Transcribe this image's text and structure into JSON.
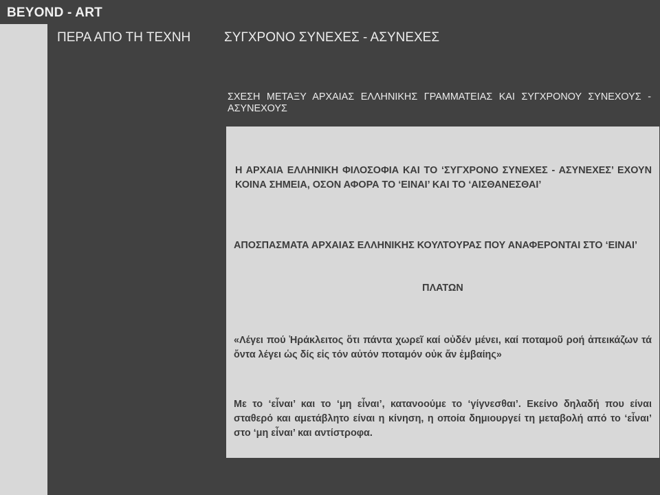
{
  "header": {
    "logo": "BEYOND - ART"
  },
  "nav": {
    "items": [
      {
        "label": "ΠΕΡΑ ΑΠΟ ΤΗ ΤΕΧΝΗ"
      },
      {
        "label": "ΣΥΓΧΡΟΝΟ ΣΥΝΕΧΕΣ - ΑΣΥΝΕΧΕΣ"
      }
    ]
  },
  "content": {
    "heading": "ΣΧΕΣΗ ΜΕΤΑΞΥ ΑΡΧΑΙΑΣ ΕΛΛΗΝΙΚΗΣ ΓΡΑΜΜΑΤΕΙΑΣ ΚΑΙ ΣΥΓΧΡΟΝΟΥ ΣΥΝΕΧΟΥΣ - ΑΣΥΝΕΧΟΥΣ",
    "paragraphs": [
      "Η ΑΡΧΑΙΑ ΕΛΛΗΝΙΚΗ ΦΙΛΟΣΟΦΙΑ ΚΑΙ ΤΟ ‘ΣΥΓΧΡΟΝΟ ΣΥΝΕΧΕΣ - ΑΣΥΝΕΧΕΣ’ ΕΧΟΥΝ ΚΟΙΝΑ ΣΗΜΕΙΑ, ΟΣΟΝ ΑΦΟΡΑ ΤΟ ‘ΕΙΝΑΙ’ ΚΑΙ ΤΟ ‘ΑΙΣΘΑΝΕΣΘΑΙ’",
      "ΑΠΟΣΠΑΣΜΑΤΑ ΑΡΧΑΙΑΣ ΕΛΛΗΝΙΚΗΣ ΚΟΥΛΤΟΥΡΑΣ ΠΟΥ ΑΝΑΦΕΡΟΝΤΑΙ ΣΤΟ ‘ΕΙΝΑΙ’",
      "ΠΛΑΤΩΝ",
      "«Λέγει πού Ἡράκλειτος ὅτι πάντα χωρεῖ καί οὐδέν μένει, καί ποταμοῦ ροή ἀπεικάζων τά ὄντα λέγει ὡς δίς εἰς τόν αὐτόν ποταμόν οὐκ ἄν ἐμβαίης»",
      "Με το ‘εἶναι’ και το ‘μη εἶναι’, κατανοούμε το ‘γίγνεσθαι’. Εκείνο δηλαδή που είναι σταθερό και αμετάβλητο είναι η κίνηση, η οποία δημιουργεί τη μεταβολή από το ‘εἶναι’ στο ‘μη εἶναι’ και αντίστροφα."
    ]
  }
}
